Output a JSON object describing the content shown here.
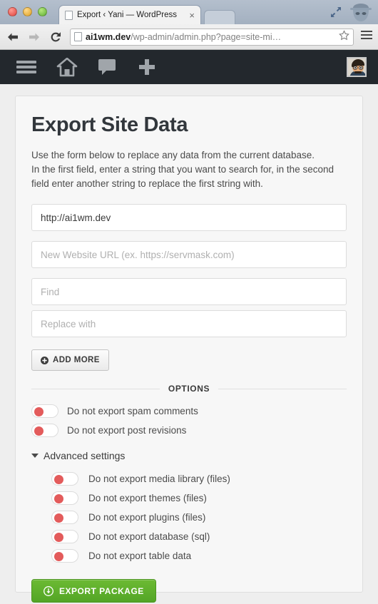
{
  "browser": {
    "tab": {
      "title": "Export ‹ Yani — WordPress",
      "close_label": "×",
      "favicon": "page-icon"
    },
    "toolbar": {
      "back_label": "Back",
      "forward_label": "Forward",
      "reload_label": "Reload",
      "url_host": "ai1wm.dev",
      "url_path": "/wp-admin/admin.php?page=site-mi…",
      "bookmark_label": "Bookmark this page",
      "menu_label": "Customize and control Google Chrome"
    },
    "window_controls": {
      "close": "close-window",
      "minimize": "minimize-window",
      "zoom": "zoom-window",
      "fullscreen": "enter-fullscreen",
      "incognito": "incognito-indicator"
    }
  },
  "adminbar": {
    "items": [
      {
        "name": "menu",
        "label": "Menu"
      },
      {
        "name": "site-home",
        "label": "Yani"
      },
      {
        "name": "comments",
        "label": "Comments"
      },
      {
        "name": "new-content",
        "label": "New"
      }
    ],
    "account": {
      "label": "Howdy, admin"
    }
  },
  "page": {
    "title": "Export Site Data",
    "intro_lines": [
      "Use the form below to replace any data from the current database.",
      "In the first field, enter a string that you want to search for, in the second",
      "field enter another string to replace the first string with."
    ],
    "fields": [
      {
        "name": "current-site-url",
        "value": "http://ai1wm.dev",
        "placeholder": ""
      },
      {
        "name": "new-site-url",
        "value": "",
        "placeholder": "New Website URL (ex. https://servmask.com)"
      },
      {
        "name": "find",
        "value": "",
        "placeholder": "Find"
      },
      {
        "name": "replace-with",
        "value": "",
        "placeholder": "Replace with"
      }
    ],
    "add_more_label": "ADD MORE",
    "options_divider_label": "OPTIONS",
    "options": [
      {
        "name": "spam-comments",
        "label": "Do not export spam comments",
        "state": "off"
      },
      {
        "name": "post-revisions",
        "label": "Do not export post revisions",
        "state": "off"
      }
    ],
    "advanced_label": "Advanced settings",
    "advanced_expanded": true,
    "advanced_options": [
      {
        "name": "media-library",
        "label": "Do not export media library (files)",
        "state": "off"
      },
      {
        "name": "themes",
        "label": "Do not export themes (files)",
        "state": "off"
      },
      {
        "name": "plugins",
        "label": "Do not export plugins (files)",
        "state": "off"
      },
      {
        "name": "database",
        "label": "Do not export database (sql)",
        "state": "off"
      },
      {
        "name": "table-data",
        "label": "Do not export table data",
        "state": "off"
      }
    ],
    "export_label": "EXPORT PACKAGE"
  },
  "colors": {
    "accent_green": "#5cb02c",
    "toggle_off": "#e35b5b",
    "adminbar_bg": "#23282d",
    "page_bg": "#eeeeee",
    "card_bg": "#f7f7f7"
  }
}
